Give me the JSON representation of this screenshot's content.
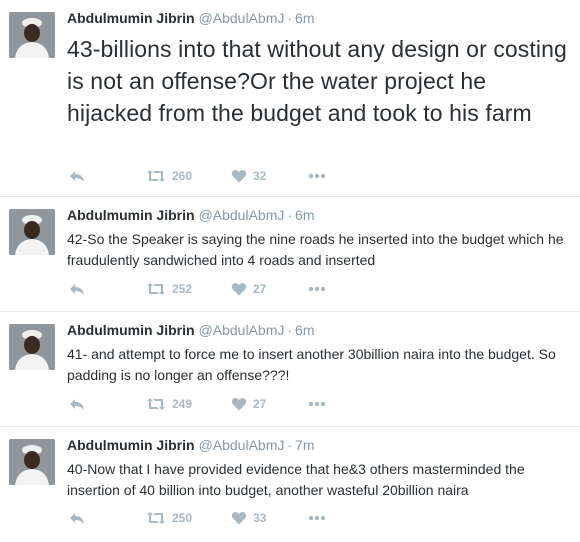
{
  "tweets": [
    {
      "name": "Abdulmumin Jibrin",
      "handle": "@AbdulAbmJ",
      "separator": "·",
      "time": "6m",
      "text": "43-billions into that without any design or costing is not an offense?Or the water project he hijacked from the budget and took to his farm",
      "retweets": "260",
      "likes": "32"
    },
    {
      "name": "Abdulmumin Jibrin",
      "handle": "@AbdulAbmJ",
      "separator": "·",
      "time": "6m",
      "text": "42-So the Speaker is saying the nine roads he inserted into the budget which he fraudulently sandwiched into 4 roads and inserted",
      "retweets": "252",
      "likes": "27"
    },
    {
      "name": "Abdulmumin Jibrin",
      "handle": "@AbdulAbmJ",
      "separator": "·",
      "time": "6m",
      "text": "41- and attempt to force me to insert another 30billion naira into the budget. So padding is no longer an offense???!",
      "retweets": "249",
      "likes": "27"
    },
    {
      "name": "Abdulmumin Jibrin",
      "handle": "@AbdulAbmJ",
      "separator": "·",
      "time": "7m",
      "text": "40-Now that I have provided evidence that he&3 others masterminded the insertion of 40 billion into budget, another wasteful 20billion naira",
      "retweets": "250",
      "likes": "33"
    }
  ],
  "icons": {
    "reply": "reply-icon",
    "retweet": "retweet-icon",
    "like": "heart-icon",
    "more": "more-icon"
  },
  "colors": {
    "text": "#292f33",
    "muted": "#8899a6",
    "action": "#aab8c2",
    "divider": "#e1e8ed"
  }
}
